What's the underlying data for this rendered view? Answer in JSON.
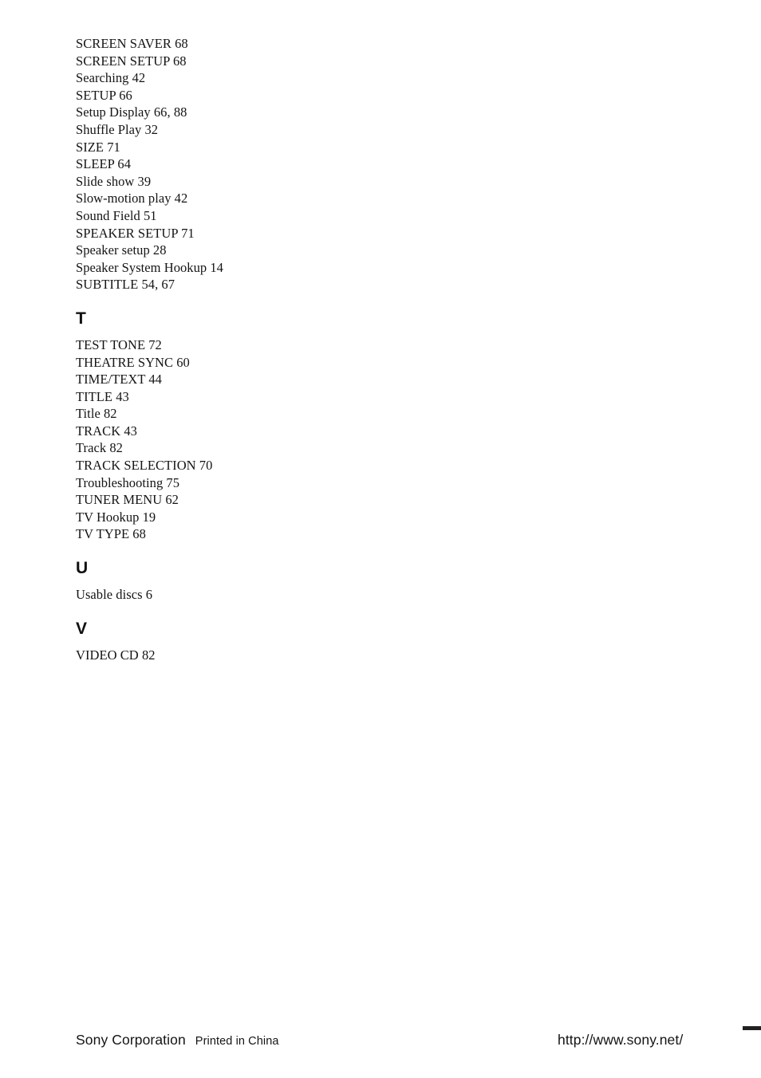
{
  "page": {
    "type": "index-page",
    "background_color": "#ffffff",
    "text_color": "#141414"
  },
  "index": {
    "groups": [
      {
        "letter": "",
        "entries": [
          "SCREEN SAVER 68",
          "SCREEN SETUP 68",
          "Searching 42",
          "SETUP 66",
          "Setup Display 66, 88",
          "Shuffle Play 32",
          "SIZE 71",
          "SLEEP 64",
          "Slide show 39",
          "Slow-motion play 42",
          "Sound Field 51",
          "SPEAKER SETUP 71",
          "Speaker setup 28",
          "Speaker System Hookup 14",
          "SUBTITLE 54, 67"
        ]
      },
      {
        "letter": "T",
        "entries": [
          "TEST TONE 72",
          "THEATRE SYNC 60",
          "TIME/TEXT 44",
          "TITLE 43",
          "Title 82",
          "TRACK 43",
          "Track 82",
          "TRACK SELECTION 70",
          "Troubleshooting 75",
          "TUNER MENU 62",
          "TV Hookup 19",
          "TV TYPE 68"
        ]
      },
      {
        "letter": "U",
        "entries": [
          "Usable discs 6"
        ]
      },
      {
        "letter": "V",
        "entries": [
          "VIDEO CD 82"
        ]
      }
    ]
  },
  "footer": {
    "corporation": "Sony Corporation",
    "printed_in": "Printed in China",
    "url": "http://www.sony.net/",
    "crop_mark_color": "#231f20"
  }
}
